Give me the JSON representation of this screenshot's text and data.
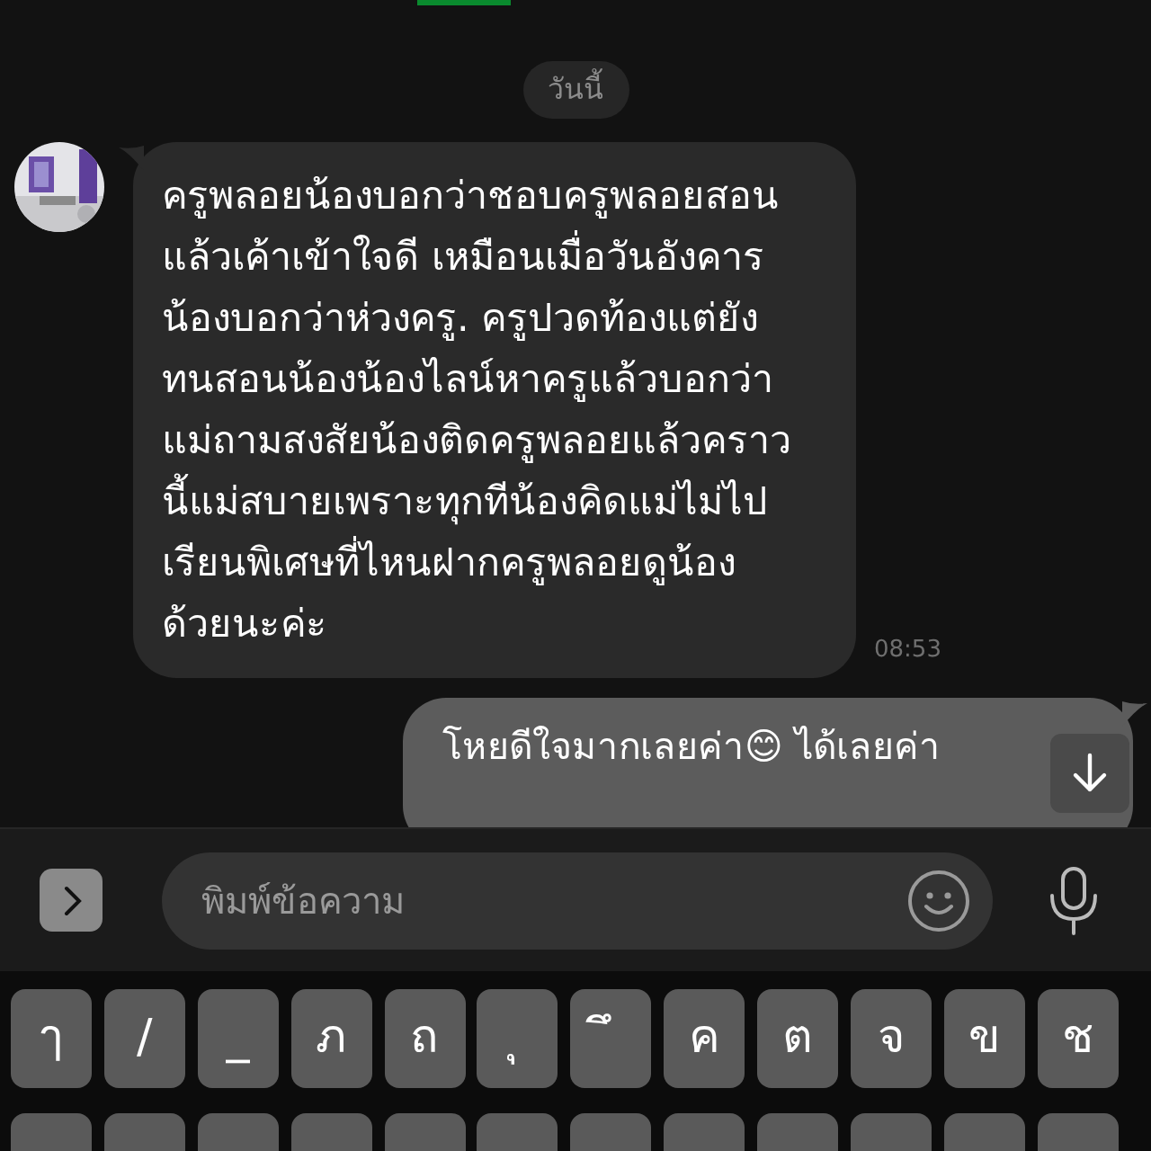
{
  "date_divider": "วันนี้",
  "messages": [
    {
      "kind": "incoming",
      "text": "ครูพลอยน้องบอกว่าชอบครูพลอยสอนแล้วเค้าเข้าใจดี เหมือนเมื่อวันอังคารน้องบอกว่าห่วงครู. ครูปวดท้องแต่ยังทนสอนน้องน้องไลน์หาครูแล้วบอกว่าแม่ถามสงสัยน้องติดครูพลอยแล้วคราวนี้แม่สบายเพราะทุกทีน้องคิดแม่ไม่ไปเรียนพิเศษที่ไหนฝากครูพลอยดูน้องด้วยนะค่ะ",
      "time": "08:53"
    },
    {
      "kind": "outgoing",
      "text": "โหยดีใจมากเลยค่า😊 ได้เลยค่า"
    }
  ],
  "input": {
    "placeholder": "พิมพ์ข้อความ"
  },
  "keyboard": {
    "row_1": [
      "ๅ",
      "/",
      "_",
      "ภ",
      "ถ",
      "ุ",
      "ึ",
      "ค",
      "ต",
      "จ",
      "ข",
      "ช"
    ]
  }
}
